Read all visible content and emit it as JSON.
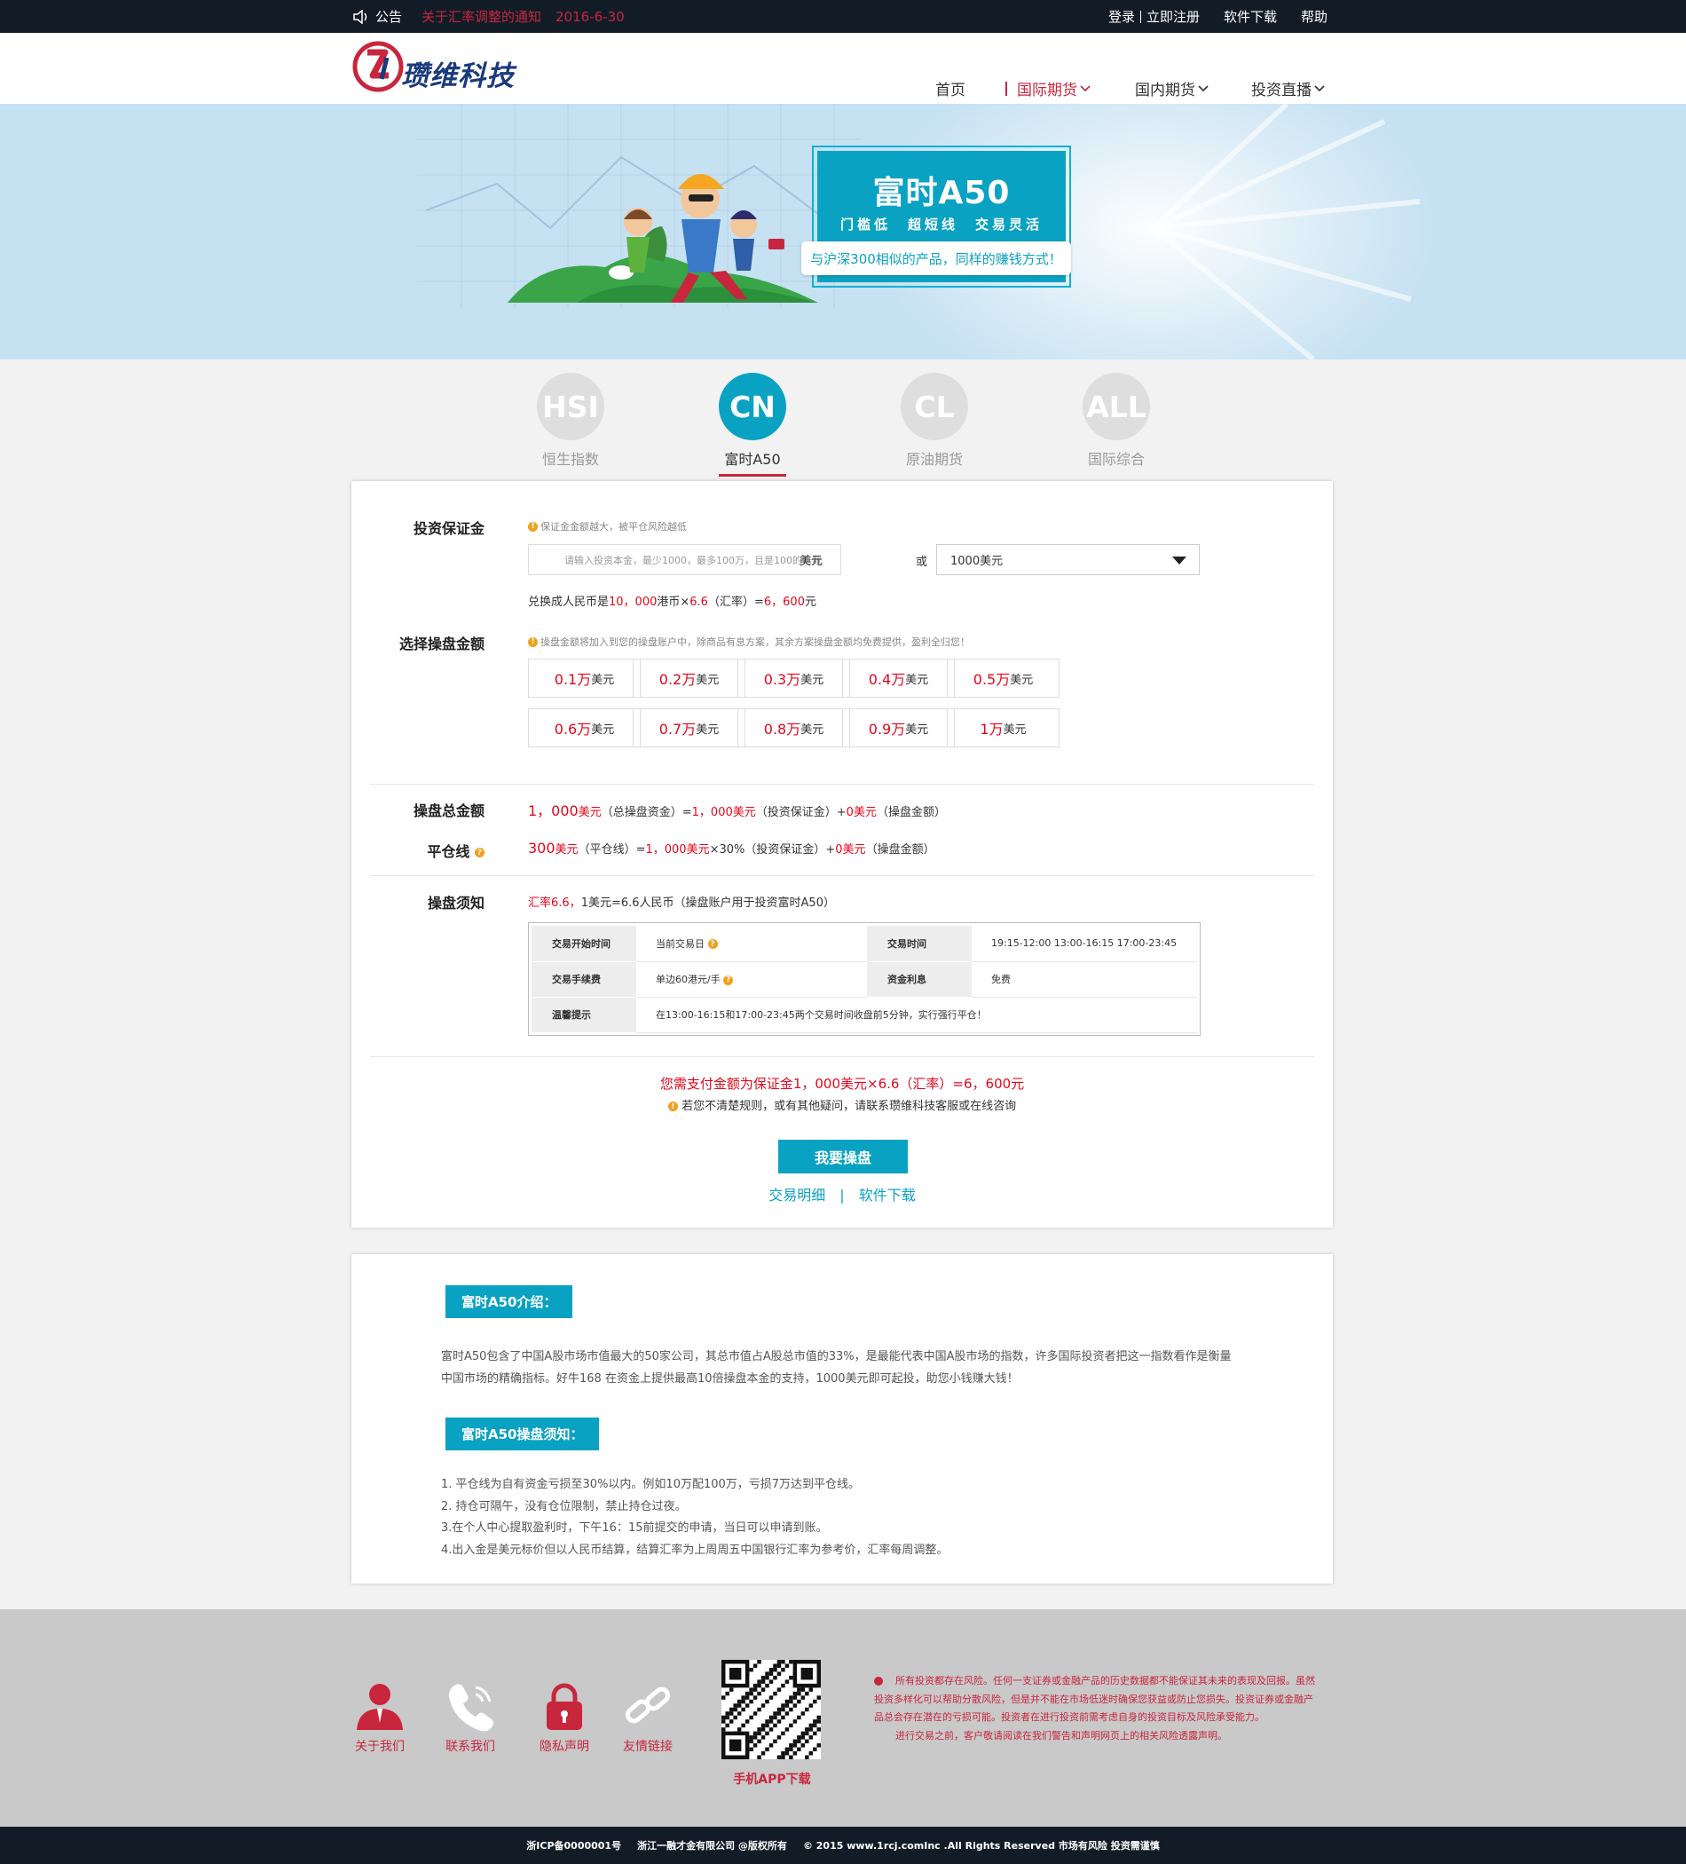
{
  "topbar": {
    "notice_label": "公告",
    "notice_title": "关于汇率调整的通知",
    "notice_date": "2016-6-30",
    "login": "登录",
    "register": "立即注册",
    "download": "软件下载",
    "help": "帮助"
  },
  "header": {
    "logo_text": "瓒维科技",
    "nav": [
      "首页",
      "国际期货",
      "国内期货",
      "投资直播"
    ]
  },
  "banner": {
    "title": "富时A50",
    "slogan": "门槛低　超短线　交易灵活",
    "sub": "与沪深300相似的产品，同样的赚钱方式！"
  },
  "tabs": [
    {
      "code": "HSI",
      "label": "恒生指数"
    },
    {
      "code": "CN",
      "label": "富时A50"
    },
    {
      "code": "CL",
      "label": "原油期货"
    },
    {
      "code": "ALL",
      "label": "国际综合"
    }
  ],
  "form": {
    "margin_label": "投资保证金",
    "margin_tip": "保证金金额越大，被平仓风险越低",
    "input_placeholder": "请输入投资本金，最少1000，最多100万，且是100的倍数",
    "input_unit": "美元",
    "or": "或",
    "select_value": "1000美元",
    "convert_prefix": "兑换成人民币是",
    "convert_hkd": "10，000",
    "convert_mid": "港币×",
    "convert_rate": "6.6",
    "convert_rate_label": "（汇率）=",
    "convert_rmb": "6，600",
    "convert_unit": "元",
    "amount_label": "选择操盘金额",
    "amount_tip": "操盘金额将加入到您的操盘账户中，除商品有息方案，其余方案操盘金额均免费提供，盈利全归您！",
    "amounts": [
      {
        "num": "0.1万",
        "unit": "美元"
      },
      {
        "num": "0.2万",
        "unit": "美元"
      },
      {
        "num": "0.3万",
        "unit": "美元"
      },
      {
        "num": "0.4万",
        "unit": "美元"
      },
      {
        "num": "0.5万",
        "unit": "美元"
      },
      {
        "num": "0.6万",
        "unit": "美元"
      },
      {
        "num": "0.7万",
        "unit": "美元"
      },
      {
        "num": "0.8万",
        "unit": "美元"
      },
      {
        "num": "0.9万",
        "unit": "美元"
      },
      {
        "num": "1万",
        "unit": "美元"
      }
    ],
    "total_label": "操盘总金额",
    "total": {
      "v1": "1，000",
      "u1": "美元",
      "t1": "（总操盘资金）=",
      "v2": "1，000",
      "u2": "美元",
      "t2": "（投资保证金）+",
      "v3": "0",
      "u3": "美元",
      "t3": "（操盘金额）"
    },
    "close_label": "平仓线",
    "close": {
      "v1": "300",
      "u1": "美元",
      "t1": "（平仓线）=",
      "v2": "1，000",
      "u2": "美元",
      "t2": "×30%（投资保证金）+",
      "v3": "0",
      "u3": "美元",
      "t3": "（操盘金额）"
    },
    "notice_label": "操盘须知",
    "rate_red": "汇率6.6，",
    "rate_text": "1美元=6.6人民币（操盘账户用于投资富时A50）",
    "table": {
      "start_h": "交易开始时间",
      "start_v": "当前交易日",
      "time_h": "交易时间",
      "time_v": "19:15-12:00 13:00-16:15 17:00-23:45",
      "fee_h": "交易手续费",
      "fee_v": "单边60港元/手",
      "interest_h": "资金利息",
      "interest_v": "免费",
      "warn_h": "温馨提示",
      "warn_v": "在13:00-16:15和17:00-23:45两个交易时间收盘前5分钟，实行强行平仓！"
    },
    "pay_line": "您需支付金额为保证金1，000美元×6.6（汇率）=6，600元",
    "help_line": "若您不清楚规则，或有其他疑问，请联系瓒维科技客服或在线咨询",
    "submit": "我要操盘",
    "link1": "交易明细",
    "link_sep": "|",
    "link2": "软件下载"
  },
  "intro": {
    "tag1": "富时A50介绍：",
    "p1": "富时A50包含了中国A股市场市值最大的50家公司，其总市值占A股总市值的33%，是最能代表中国A股市场的指数，许多国际投资者把这一指数看作是衡量中国市场的精确指标。好牛168 在资金上提供最高10倍操盘本金的支持，1000美元即可起投，助您小钱赚大钱！",
    "tag2": "富时A50操盘须知：",
    "rules": [
      "1. 平仓线为自有资金亏损至30%以内。例如10万配100万，亏损7万达到平仓线。",
      "2. 持仓可隔午，没有仓位限制，禁止持仓过夜。",
      "3.在个人中心提取盈利时，下午16：15前提交的申请，当日可以申请到账。",
      "4.出入金是美元标价但以人民币结算，结算汇率为上周周五中国银行汇率为参考价，汇率每周调整。"
    ]
  },
  "footer": {
    "items": [
      "关于我们",
      "联系我们",
      "隐私声明",
      "友情链接"
    ],
    "app": "手机APP下载",
    "risk1": "所有投资都存在风险。任何一支证券或金融产品的历史数据都不能保证其未来的表现及回报。虽然投资多样化可以帮助分散风险，但是并不能在市场低迷时确保您获益或防止您损失。投资证券或金融产品总会存在潜在的亏损可能。投资者在进行投资前需考虑自身的投资目标及风险承受能力。",
    "risk2": "进行交易之前，客户敬请阅读在我们警告和声明网页上的相关风险透露声明。",
    "icp": "浙ICP备0000001号",
    "company": "浙江一融才金有限公司 @版权所有",
    "copyright": "© 2015 www.1rcj.comInc .All Rights Reserved 市场有风险 投资需谨慎"
  },
  "colors": {
    "accent": "#0aa2c2",
    "brand_red": "#c8263d",
    "dark_bar": "#111c27",
    "price_red": "#e0071b"
  }
}
